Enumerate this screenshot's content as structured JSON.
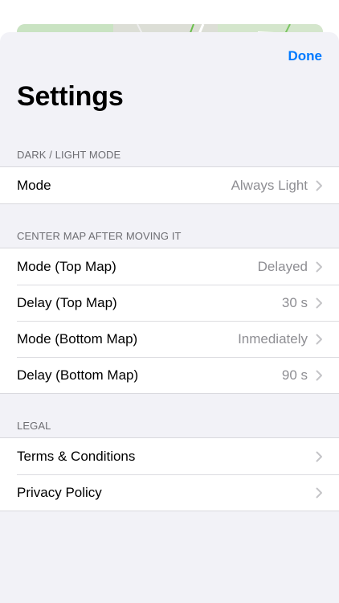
{
  "header": {
    "done_label": "Done",
    "title": "Settings"
  },
  "sections": [
    {
      "header": "DARK / LIGHT MODE",
      "rows": [
        {
          "label": "Mode",
          "value": "Always Light"
        }
      ]
    },
    {
      "header": "CENTER MAP AFTER MOVING IT",
      "rows": [
        {
          "label": "Mode (Top Map)",
          "value": "Delayed"
        },
        {
          "label": "Delay (Top Map)",
          "value": "30 s"
        },
        {
          "label": "Mode (Bottom Map)",
          "value": "Inmediately"
        },
        {
          "label": "Delay (Bottom Map)",
          "value": "90 s"
        }
      ]
    },
    {
      "header": "LEGAL",
      "rows": [
        {
          "label": "Terms & Conditions",
          "value": ""
        },
        {
          "label": "Privacy Policy",
          "value": ""
        }
      ]
    }
  ],
  "colors": {
    "accent": "#007aff",
    "grouped_background": "#f2f2f7",
    "secondary_text": "#8e8e93",
    "section_header": "#6d6d72"
  },
  "icons": {
    "disclosure": "chevron-right-icon"
  }
}
